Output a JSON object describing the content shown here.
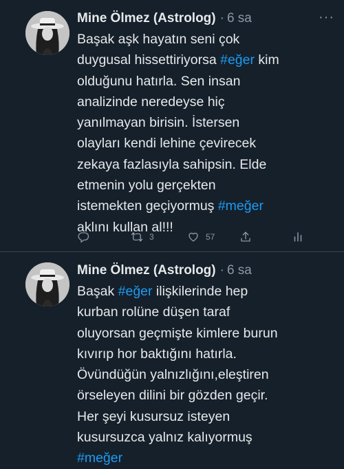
{
  "tweets": [
    {
      "author": "Mine Ölmez (Astrolog)",
      "separator": "·",
      "time": "6 sa",
      "more": "···",
      "lines": [
        [
          {
            "t": "Başak aşk hayatın seni çok"
          }
        ],
        [
          {
            "t": "duygusal hissettiriyorsa "
          },
          {
            "t": "#eğer",
            "h": true
          },
          {
            "t": " kim"
          }
        ],
        [
          {
            "t": "olduğunu hatırla. Sen insan"
          }
        ],
        [
          {
            "t": "analizinde neredeyse hiç"
          }
        ],
        [
          {
            "t": "yanılmayan birisin. İstersen"
          }
        ],
        [
          {
            "t": "olayları kendi lehine çevirecek"
          }
        ],
        [
          {
            "t": "zekaya fazlasıyla sahipsin. Elde"
          }
        ],
        [
          {
            "t": "etmenin yolu gerçekten"
          }
        ],
        [
          {
            "t": "istemekten geçiyormuş "
          },
          {
            "t": "#meğer",
            "h": true
          }
        ],
        [
          {
            "t": "aklını kullan al!!!"
          }
        ]
      ],
      "actions": {
        "reply_icon": "reply-icon",
        "retweet_icon": "retweet-icon",
        "retweet_count": "3",
        "like_icon": "heart-icon",
        "like_count": "57",
        "share_icon": "share-icon",
        "analytics_icon": "analytics-icon"
      }
    },
    {
      "author": "Mine Ölmez (Astrolog)",
      "separator": "·",
      "time": "6 sa",
      "lines": [
        [
          {
            "t": "Başak "
          },
          {
            "t": "#eğer",
            "h": true
          },
          {
            "t": " ilişkilerinde hep"
          }
        ],
        [
          {
            "t": "kurban rolüne düşen taraf"
          }
        ],
        [
          {
            "t": "oluyorsan geçmişte kimlere burun"
          }
        ],
        [
          {
            "t": "kıvırıp hor baktığını hatırla."
          }
        ],
        [
          {
            "t": "Övündüğün yalnızlığını,eleştiren"
          }
        ],
        [
          {
            "t": "örseleyen dilini bir gözden geçir."
          }
        ],
        [
          {
            "t": "Her şeyi kusursuz isteyen"
          }
        ],
        [
          {
            "t": "kusursuzca yalnız kalıyormuş"
          }
        ],
        [
          {
            "t": "#meğer",
            "h": true
          }
        ]
      ]
    }
  ],
  "colors": {
    "background": "#15202b",
    "text": "#e7e9ea",
    "secondary": "#8b98a5",
    "hashtag": "#1d9bf0",
    "divider": "#38444d"
  }
}
